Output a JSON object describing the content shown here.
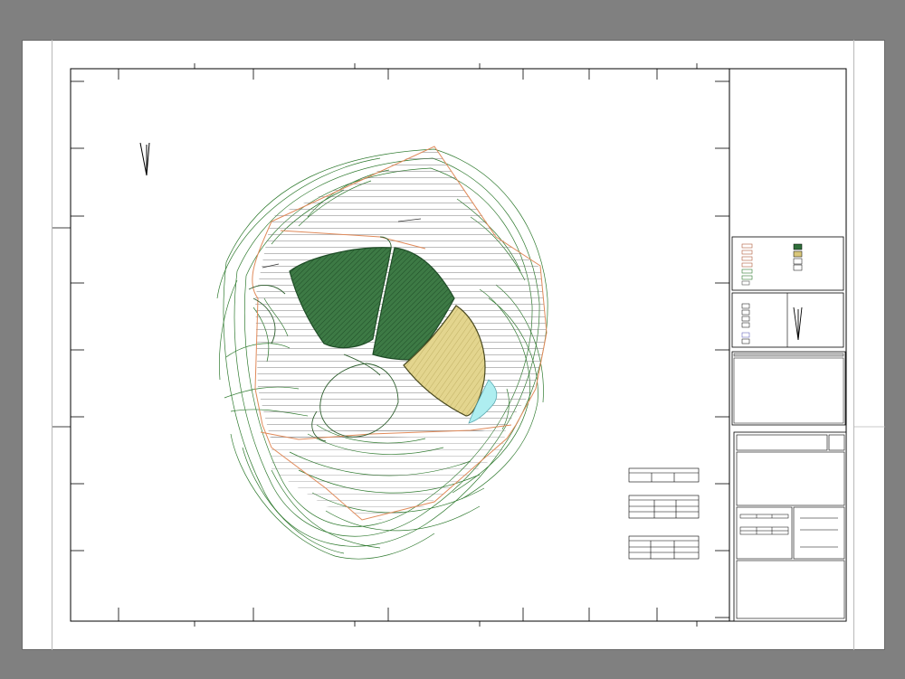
{
  "window": {
    "background": "#808080",
    "paper_color": "#ffffff",
    "border_color": "#000000"
  },
  "drawing": {
    "colors": {
      "contour": "#2f7a2f",
      "boundary": "#e08a5a",
      "zone_dark": "#2f6f3a",
      "zone_yellow": "#d9c77a",
      "zone_cyan": "#aeeef0",
      "hatch": "#555555"
    },
    "north_arrow": "north-arrow-icon"
  },
  "legend": {
    "swatch_colors": [
      "#2f6f3a",
      "#d9c77a",
      "#ffffff",
      "#ffffff"
    ]
  },
  "footer": {
    "scale_text": ""
  }
}
